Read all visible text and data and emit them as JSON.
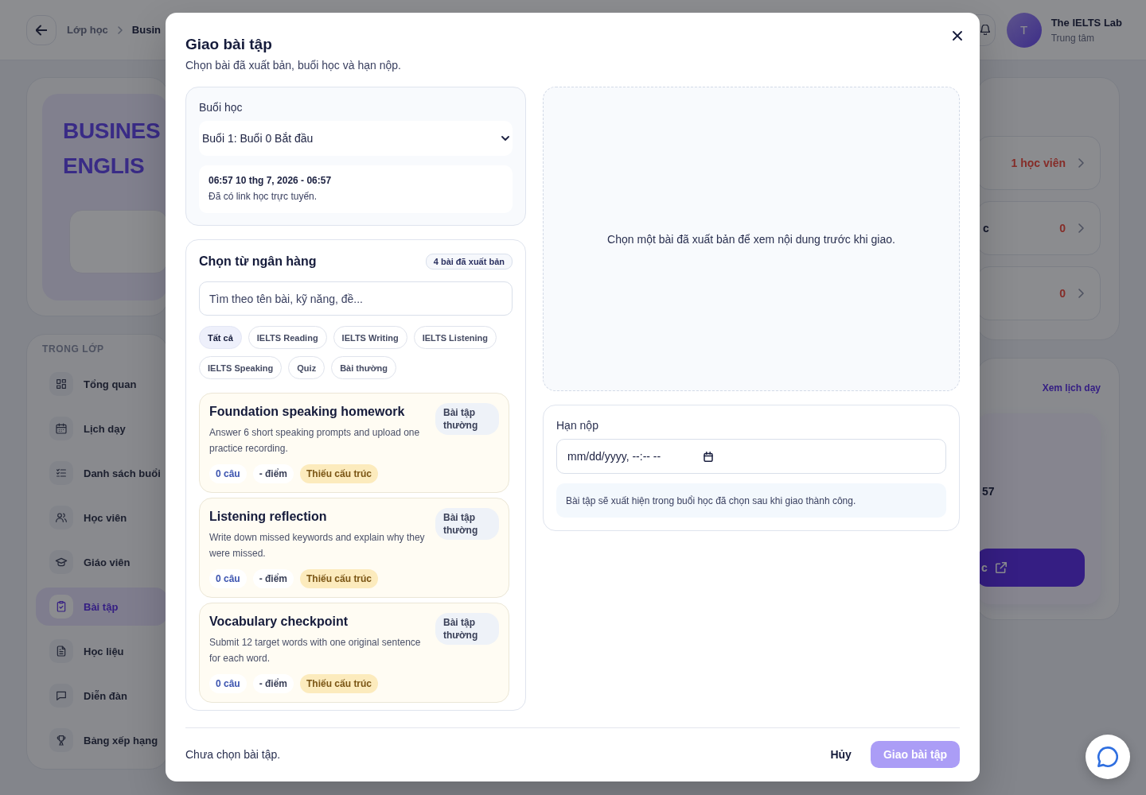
{
  "topbar": {
    "breadcrumb": [
      "Lớp học",
      "Busin"
    ],
    "user": {
      "initial": "T",
      "name": "The IELTS Lab",
      "role": "Trung tâm"
    }
  },
  "course_banner": {
    "title": "BUSINES ENGLIS"
  },
  "stat_rows": [
    {
      "value": "1 học viên"
    },
    {
      "label": "c",
      "value": "0"
    },
    {
      "value": "0"
    }
  ],
  "sidebar": {
    "heading": "TRONG LỚP",
    "items": [
      {
        "label": "Tổng quan",
        "selected": false
      },
      {
        "label": "Lịch dạy",
        "selected": false
      },
      {
        "label": "Danh sách buổi",
        "selected": false
      },
      {
        "label": "Học viên",
        "selected": false
      },
      {
        "label": "Giáo viên",
        "selected": false
      },
      {
        "label": "Bài tập",
        "selected": true
      },
      {
        "label": "Học liệu",
        "selected": false
      },
      {
        "label": "Diễn đàn",
        "selected": false
      },
      {
        "label": "Bảng xếp hạng",
        "selected": false
      }
    ]
  },
  "schedule": {
    "link": "Xem lịch dạy",
    "text_fragment": "57",
    "button": "c"
  },
  "modal": {
    "title": "Giao bài tập",
    "subtitle": "Chọn bài đã xuất bản, buổi học và hạn nộp.",
    "session": {
      "label": "Buổi học",
      "value": "Buổi 1: Buổi 0 Bắt đầu",
      "time": "06:57 10 thg 7, 2026 - 06:57",
      "note": "Đã có link học trực tuyến."
    },
    "bank": {
      "title": "Chọn từ ngân hàng",
      "count": "4 bài đã xuất bản",
      "search": {
        "placeholder": "Tìm theo tên bài, kỹ năng, đề..."
      },
      "filters": [
        {
          "label": "Tất cả",
          "selected": true
        },
        {
          "label": "IELTS Reading",
          "selected": false
        },
        {
          "label": "IELTS Writing",
          "selected": false
        },
        {
          "label": "IELTS Listening",
          "selected": false
        },
        {
          "label": "IELTS Speaking",
          "selected": false
        },
        {
          "label": "Quiz",
          "selected": false
        },
        {
          "label": "Bài thường",
          "selected": false
        }
      ],
      "assignments": [
        {
          "title": "Foundation speaking homework",
          "type": "Bài tập thường",
          "description": "Answer 6 short speaking prompts and upload one practice recording.",
          "questions": "0 câu",
          "points": "- điểm",
          "status": "Thiếu cấu trúc"
        },
        {
          "title": "Listening reflection",
          "type": "Bài tập thường",
          "description": "Write down missed keywords and explain why they were missed.",
          "questions": "0 câu",
          "points": "- điểm",
          "status": "Thiếu cấu trúc"
        },
        {
          "title": "Vocabulary checkpoint",
          "type": "Bài tập thường",
          "description": "Submit 12 target words with one original sentence for each word.",
          "questions": "0 câu",
          "points": "- điểm",
          "status": "Thiếu cấu trúc"
        }
      ]
    },
    "preview": {
      "empty_text": "Chọn một bài đã xuất bản để xem nội dung trước khi giao."
    },
    "due": {
      "label": "Hạn nộp",
      "placeholder": "mm/dd/yyyy, --:-- --",
      "note": "Bài tập sẽ xuất hiện trong buổi học đã chọn sau khi giao thành công."
    },
    "footer": {
      "status": "Chưa chọn bài tập.",
      "cancel": "Hủy",
      "submit": {
        "label": "Giao bài tập",
        "disabled": true
      }
    }
  }
}
